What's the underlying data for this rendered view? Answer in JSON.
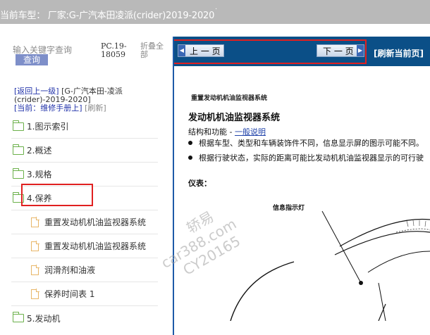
{
  "header": {
    "current_car": "当前车型： 厂家:G-广汽本田凌派(crider)2019-2020",
    "dot": "·"
  },
  "search": {
    "placeholder": "输入关键字查询",
    "button_label": "查询"
  },
  "doc_code": "PC.19-18059",
  "collapse_all": "折叠全部",
  "nav": {
    "back": "[返回上一级]",
    "brand": "[G-广汽本田-凌派(crider)-2019-2020]",
    "current": "[当前：维修手册上]",
    "refresh": "[刷新]"
  },
  "tree": [
    {
      "label": "1.图示索引",
      "type": "folder"
    },
    {
      "label": "2.概述",
      "type": "folder"
    },
    {
      "label": "3.规格",
      "type": "folder"
    },
    {
      "label": "4.保养",
      "type": "folder"
    },
    {
      "label": "重置发动机机油监视器系统",
      "type": "doc"
    },
    {
      "label": "重置发动机机油监视器系统",
      "type": "doc"
    },
    {
      "label": "润滑剂和油液",
      "type": "doc"
    },
    {
      "label": "保养时间表 1",
      "type": "doc"
    },
    {
      "label": "5.发动机",
      "type": "folder"
    }
  ],
  "toolbar": {
    "prev_label": "上 一 页",
    "next_label": "下 一 页",
    "refresh_home": "[刷新当前页]"
  },
  "document": {
    "breadcrumb": "重置发动机机油监视器系统",
    "title": "发动机机油监视器系统",
    "subtitle_prefix": "结构和功能 - ",
    "subtitle_link": "一般说明",
    "bullet1": "根据车型、类型和车辆装饰件不同，信息显示屏的图示可能不同。",
    "bullet2": "根据行驶状态，实际的距离可能比发动机机油监视器显示的可行驶",
    "meter_label": "仪表：",
    "indicator_label": "信息指示灯"
  },
  "watermark": {
    "line1": "轿易",
    "line2": "car388.com",
    "line3": "CY20165"
  }
}
